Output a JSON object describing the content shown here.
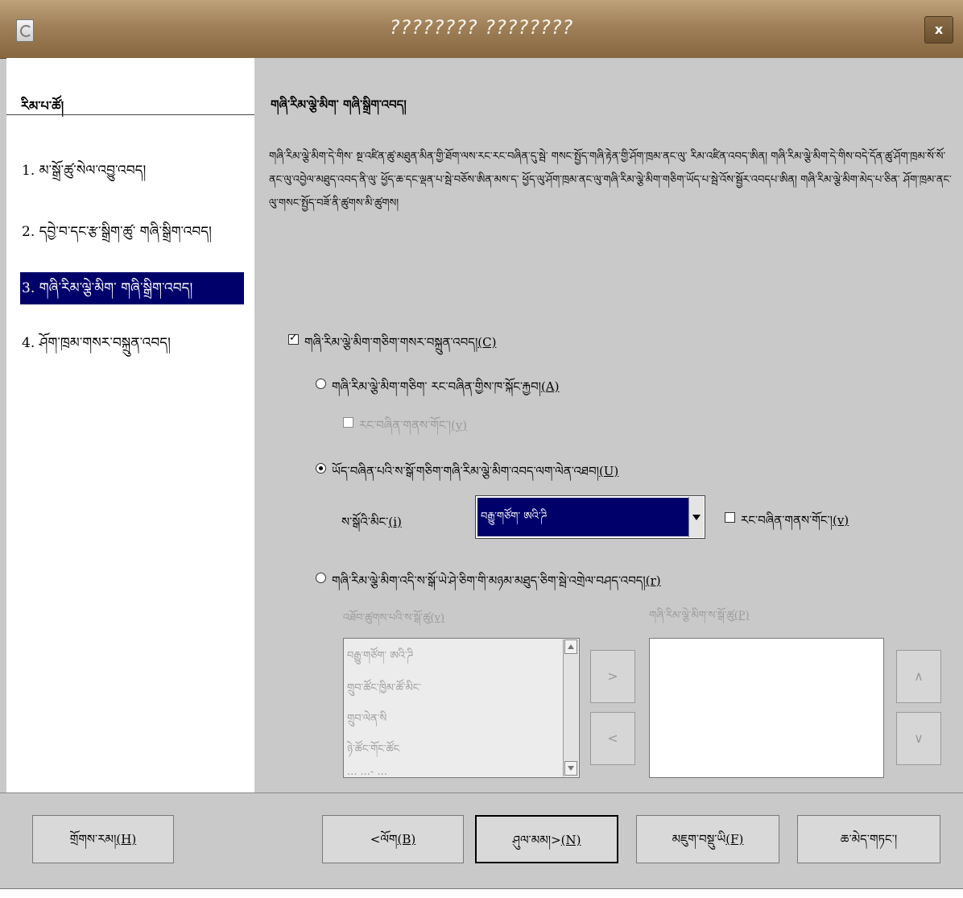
{
  "window": {
    "title": "???????? ????????",
    "close_label": "x"
  },
  "sidebar": {
    "heading": "རིམ་པ་ཚོ།",
    "steps": [
      {
        "label": "1.  མ་སྒྲོ་ཚུ་སེལ་འབྱུ་འབད།"
      },
      {
        "label": "2.  དབྱེ་བ་དང་རྩ་སྒྲིག་ཚུ་ གཞི་སྒྲིག་འབད།"
      },
      {
        "label": "3.  གཞི་རིམ་ལྕེ་མིག་ གཞི་སྒྲིག་འབད།"
      },
      {
        "label": "4.  ཤོག་ཁྲམ་གསར་བསྐྲུན་འབད།"
      }
    ],
    "active_index": 2
  },
  "main": {
    "page_title": "གཞི་རིམ་ལྕེ་མིག་ གཞི་སྒྲིག་འབད།",
    "description": "གཞི་རིམ་ལྕེ་མིག་དེ་གིས་ སྔ་འཛིན་ཚུ་མཐུན་མིན་གྱི་ཐོག་ལས་རང་རང་བཞིན་དུ་སྦེ་ གསང་སྤྱོད་གཞི་རྟེན་གྱི་ཤོག་ཁྲམ་ནང་ལུ་ རིམ་འཛིན་འབད་ཨིན། གཞི་རིམ་ལྕེ་མིག་དེ་གིས་བདེ་དོན་ཚུ་ཤོག་ཁྲམ་སོ་སོ་ནང་ལུ་འབྱེལ་མཐུད་འབད་ནི་ལུ་ ཕྱོད་ཆ་དང་ལྡན་པ་སྦེ་བཅོས་ཨིན་མས་ད་ ཕྱོད་ལུ་ཤོག་ཁྲམ་ནང་ལུ་གཞི་རིམ་ལྕེ་མིག་གཅིག་ཡོད་པ་སྦེ་འོས་སྦྱོར་འབདཔ་ཨིན། གཞི་རིམ་ལྕེ་མིག་མེད་པ་ཅིན་ ཤོག་ཁྲམ་ནང་ལུ་གསང་སྤྱོད་བཟོ་ནི་ཚུགས་མི་ཚུགས།",
    "create_pk_label": "གཞི་རིམ་ལྕེ་མིག་གཅིག་གསར་བསྐྲུན་འབད།",
    "create_pk_mnemonic": "(C)",
    "create_pk_checked": true,
    "option_auto_label": "གཞི་རིམ་ལྕེ་མིག་གཅིག་ རང་བཞིན་གྱིས་ཁ་སྐོང་རྐྱབ།",
    "option_auto_mnemonic": "(A)",
    "auto_value_label": "རང་བཞིན་གནས་གོང་།",
    "auto_value_mnemonic": "(y)",
    "option_existing_label": "ཡོད་བཞིན་པའི་ས་སྒོ་གཅིག་གཞི་རིམ་ལྕེ་མིག་འབད་ལག་ལེན་འཐབ།",
    "option_existing_mnemonic": "(U)",
    "fieldname_label": "ས་སྒོའི་མིང་",
    "fieldname_mnemonic": "(i)",
    "fieldname_value": "བརྒྱུ་གཙོག་ ཨའི་ཌི",
    "existing_auto_label": "རང་བཞིན་གནས་གོང་།",
    "existing_auto_mnemonic": "(v)",
    "option_combined_label": "གཞི་རིམ་ལྕེ་མིག་འདི་ས་སྒོ་ཡེ་ཤེ་ཅིག་གི་མཉམ་མཐུད་ཅིག་སྦེ་འགྲེལ་བཤད་འབད།",
    "option_combined_mnemonic": "(r)",
    "selected_option": "existing",
    "available_fields_label": "འཐོབ་ཚུགས་པའི་ས་སྒོ་ཚུ",
    "available_fields_mnemonic": "(v)",
    "pk_fields_label": "གཞི་རིམ་ལྕེ་མིག་ས་སྒོ་ཚུ",
    "pk_fields_mnemonic": "(P)",
    "available_fields": [
      "བརྒྱུ་གཙོག་ ཨའི་ཌི",
      "གྲུབ་ཚོང་ཁྱིམ་ཚོ་མིང་",
      "གྲུབ་ལེན་སི",
      "ཉེ་ཚོང་གོང་ཚོང",
      "... ...- ..."
    ],
    "pk_fields": [],
    "add_label": ">",
    "remove_label": "<",
    "up_label": "∧",
    "down_label": "∨"
  },
  "buttons": {
    "help": "གྲོགས་རམ།",
    "help_mnemonic": "(H)",
    "back": "<ལོག",
    "back_mnemonic": "(B)",
    "next": "ཤུལ་མམ།>",
    "next_mnemonic": "(N)",
    "finish": "མཇུག་བསྡུ་ཡི",
    "finish_mnemonic": "(F)",
    "cancel": "ཆ་མེད་གཏང་།"
  }
}
